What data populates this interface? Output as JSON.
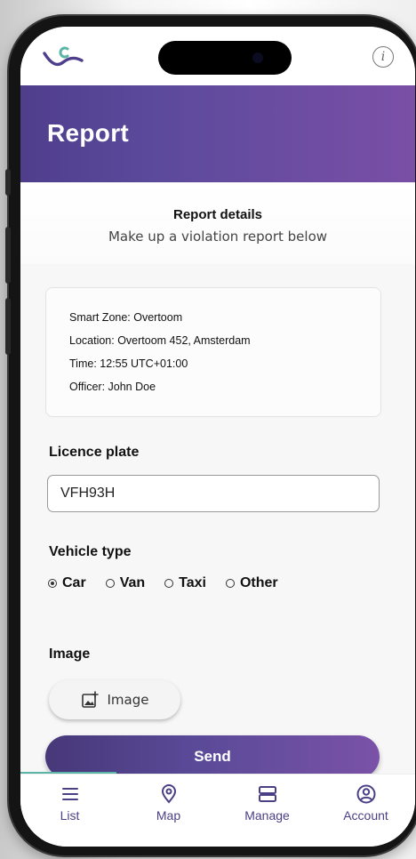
{
  "header": {
    "title": "Report"
  },
  "subheader": {
    "title": "Report details",
    "subtitle": "Make up a violation report below"
  },
  "info_card": {
    "lines": [
      "Smart Zone: Overtoom",
      "Location: Overtoom 452, Amsterdam",
      "Time: 12:55 UTC+01:00",
      "Officer: John Doe"
    ]
  },
  "form": {
    "licence_plate_label": "Licence plate",
    "licence_plate_value": "VFH93H",
    "vehicle_type_label": "Vehicle type",
    "vehicle_types": [
      "Car",
      "Van",
      "Taxi",
      "Other"
    ],
    "selected_vehicle_type": "Car",
    "image_label": "Image",
    "image_button_label": "Image",
    "send_button_label": "Send"
  },
  "tabbar": {
    "items": [
      {
        "label": "List",
        "icon": "list-icon"
      },
      {
        "label": "Map",
        "icon": "map-pin-icon"
      },
      {
        "label": "Manage",
        "icon": "manage-icon"
      },
      {
        "label": "Account",
        "icon": "account-icon"
      }
    ]
  },
  "colors": {
    "header_gradient_start": "#4f3e8c",
    "header_gradient_end": "#7a4fa6",
    "tab_accent": "#4b3f86",
    "active_indicator": "#5bb5a6"
  }
}
